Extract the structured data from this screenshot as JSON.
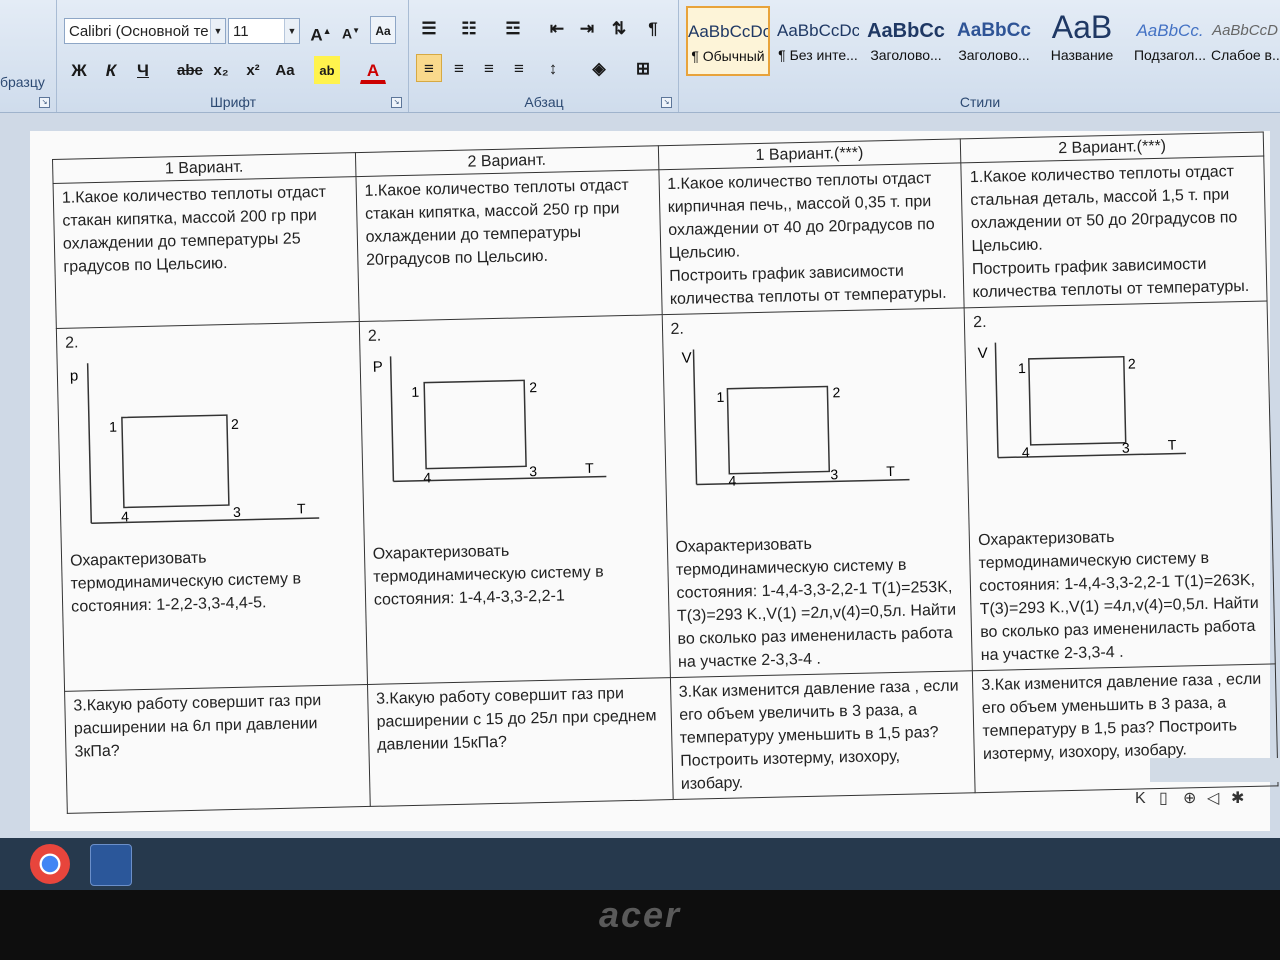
{
  "ribbon": {
    "left_label": "бразцу",
    "font_name": "Calibri (Основной те",
    "font_size": "11",
    "font_group": "Шрифт",
    "paragraph_group": "Абзац",
    "styles_group": "Стили",
    "format_buttons": [
      "Ж",
      "К",
      "Ч",
      "abe",
      "x₂",
      "x²",
      "Aa"
    ],
    "styles": [
      {
        "sample": "AaBbCcDc",
        "name": "¶ Обычный"
      },
      {
        "sample": "AaBbCcDc",
        "name": "¶ Без инте..."
      },
      {
        "sample": "AaBbCc",
        "name": "Заголово..."
      },
      {
        "sample": "AaBbCc",
        "name": "Заголово..."
      },
      {
        "sample": "AaB",
        "name": "Название"
      },
      {
        "sample": "AaBbCc.",
        "name": "Подзагол..."
      },
      {
        "sample": "AaBbCcD",
        "name": "Слабое в..."
      }
    ]
  },
  "table": {
    "headers": [
      "1 Вариант.",
      "2 Вариант.",
      "1 Вариант.(***)",
      "2 Вариант.(***)"
    ],
    "q1": [
      "1.Какое количество теплоты отдаст стакан кипятка, массой 200  гр при охлаждении до температуры 25 градусов по Цельсию.",
      "1.Какое количество теплоты отдаст стакан кипятка, массой 250  гр при охлаждении до температуры 20градусов по Цельсию.",
      "1.Какое количество теплоты отдаст кирпичная печь,, массой 0,35 т. при охлаждении от 40 до  20градусов по Цельсию.",
      "1.Какое количество теплоты отдаст стальная деталь, массой 1,5 т. при охлаждении от 50 до 20градусов по Цельсию."
    ],
    "q1_extra": [
      "",
      "",
      "Построить график зависимости количества теплоты от температуры.",
      "Построить график зависимости количества теплоты от температуры."
    ],
    "q2_num": "2.",
    "graphs": [
      {
        "y_axis": "p",
        "x_axis": "T",
        "points": [
          "1",
          "2",
          "3",
          "4"
        ]
      },
      {
        "y_axis": "P",
        "x_axis": "T",
        "points": [
          "1",
          "2",
          "3",
          "4"
        ]
      },
      {
        "y_axis": "V",
        "x_axis": "T",
        "points": [
          "1",
          "2",
          "3",
          "4"
        ]
      },
      {
        "y_axis": "V",
        "x_axis": "T",
        "points": [
          "1",
          "2",
          "3",
          "4"
        ]
      }
    ],
    "q2_text": [
      "Охарактеризовать термодинамическую систему в состояния: 1-2,2-3,3-4,4-5.",
      "Охарактеризовать термодинамическую систему в состояния: 1-4,4-3,3-2,2-1",
      "Охарактеризовать термодинамическую систему в состояния: 1-4,4-3,3-2,2-1 T(1)=253K, T(3)=293 K.,V(1) =2л,v(4)=0,5л. Найти во сколько раз именениласть работа на участке 2-3,3-4 .",
      "Охарактеризовать термодинамическую систему в состояния: 1-4,4-3,3-2,2-1 T(1)=263K, T(3)=293 K.,V(1) =4л,v(4)=0,5л. Найти во сколько раз именениласть работа на участке 2-3,3-4 ."
    ],
    "q3": [
      "3.Какую работу совершит газ при расширении на 6л при давлении 3кПа?",
      "3.Какую работу совершит газ при расширении с 15 до 25л при среднем давлении 15кПа?",
      "3.Как  изменится давление газа , если его объем увеличить в 3 раза, а температуру уменьшить в 1,5 раз? Построить изотерму, изохору, изобару.",
      "3.Как  изменится давление газа , если его объем уменьшить в 3 раза, а температуру в 1,5 раз? Построить изотерму, изохору, изобару."
    ]
  },
  "monitor_brand": "acer"
}
